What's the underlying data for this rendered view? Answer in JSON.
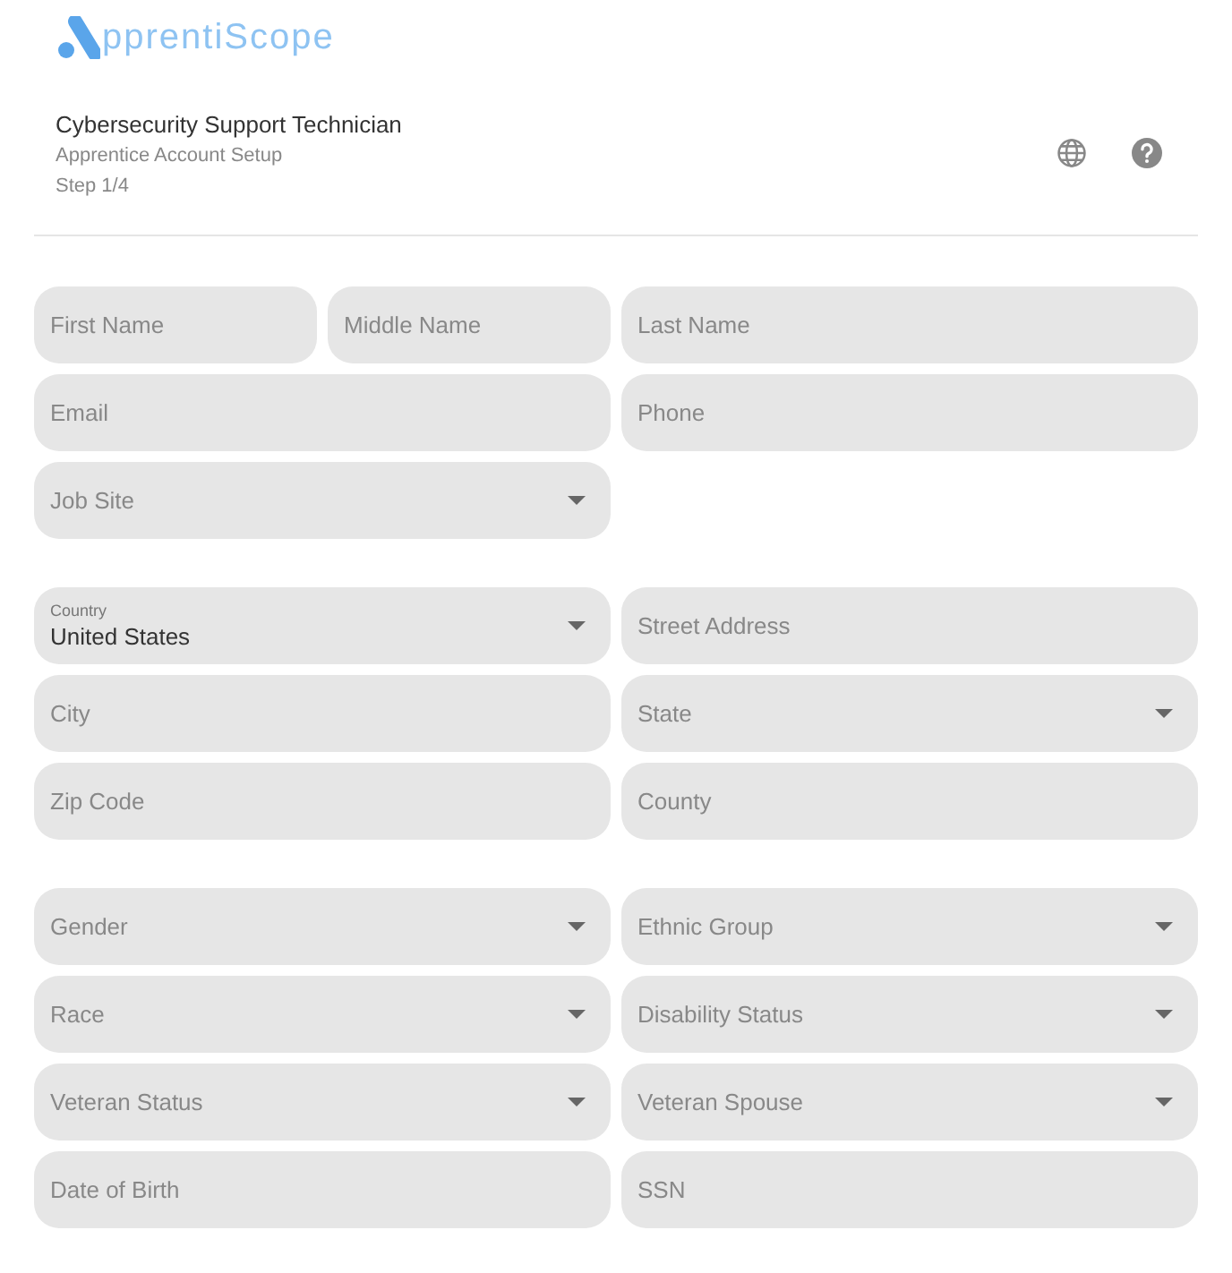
{
  "logo": {
    "text": "pprentiScope"
  },
  "header": {
    "title": "Cybersecurity Support Technician",
    "subtitle": "Apprentice Account Setup",
    "step": "Step 1/4"
  },
  "sections": [
    {
      "rows": [
        [
          {
            "kind": "group",
            "fields": [
              {
                "kind": "text",
                "placeholder": "First Name"
              },
              {
                "kind": "text",
                "placeholder": "Middle Name"
              }
            ]
          },
          {
            "kind": "text",
            "placeholder": "Last Name"
          }
        ],
        [
          {
            "kind": "text",
            "placeholder": "Email"
          },
          {
            "kind": "text",
            "placeholder": "Phone"
          }
        ],
        [
          {
            "kind": "select",
            "placeholder": "Job Site"
          }
        ]
      ]
    },
    {
      "rows": [
        [
          {
            "kind": "select",
            "label": "Country",
            "value": "United States"
          },
          {
            "kind": "text",
            "placeholder": "Street Address"
          }
        ],
        [
          {
            "kind": "text",
            "placeholder": "City"
          },
          {
            "kind": "select",
            "placeholder": "State"
          }
        ],
        [
          {
            "kind": "text",
            "placeholder": "Zip Code"
          },
          {
            "kind": "text",
            "placeholder": "County"
          }
        ]
      ]
    },
    {
      "rows": [
        [
          {
            "kind": "select",
            "placeholder": "Gender"
          },
          {
            "kind": "select",
            "placeholder": "Ethnic Group"
          }
        ],
        [
          {
            "kind": "select",
            "placeholder": "Race"
          },
          {
            "kind": "select",
            "placeholder": "Disability Status"
          }
        ],
        [
          {
            "kind": "select",
            "placeholder": "Veteran Status"
          },
          {
            "kind": "select",
            "placeholder": "Veteran Spouse"
          }
        ],
        [
          {
            "kind": "text",
            "placeholder": "Date of Birth"
          },
          {
            "kind": "text",
            "placeholder": "SSN"
          }
        ]
      ]
    }
  ]
}
